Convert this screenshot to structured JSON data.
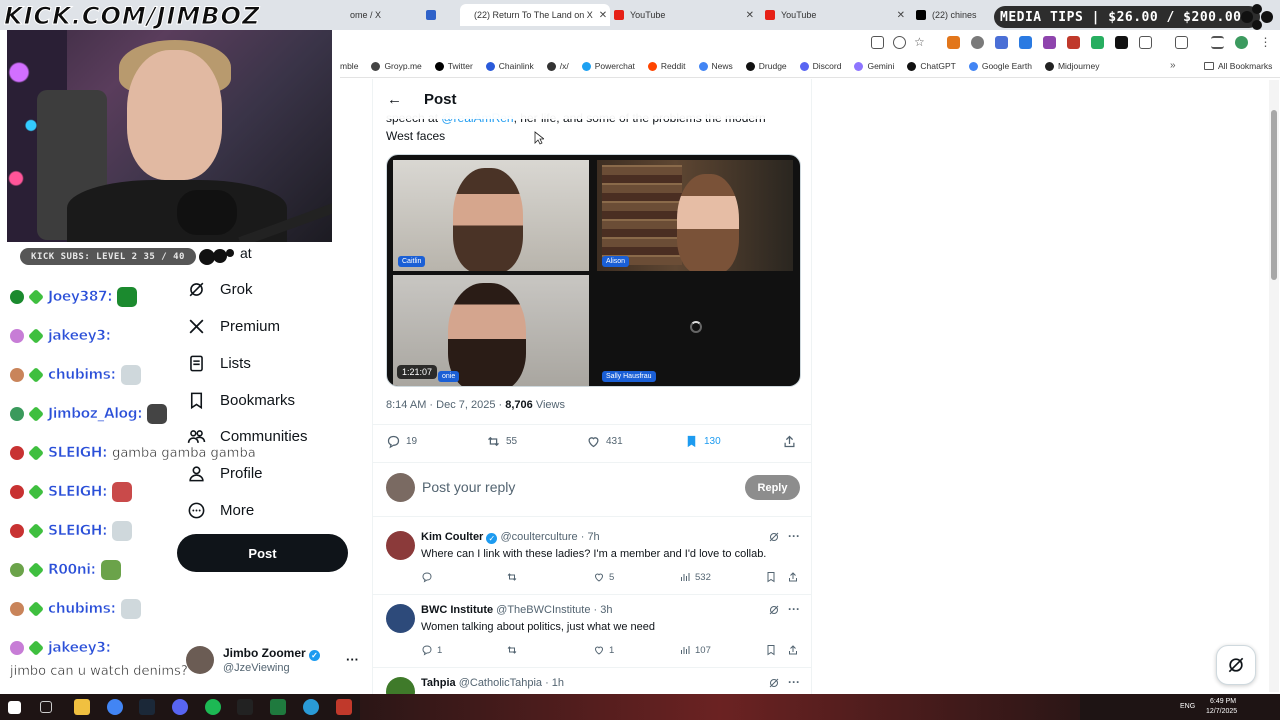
{
  "browser": {
    "tabs": [
      {
        "label": "ome / X",
        "color": "#000000"
      },
      {
        "label": "(22) Return To The Land on X",
        "color": "#000000"
      },
      {
        "label": "YouTube",
        "color": "#ff0000"
      },
      {
        "label": "YouTube",
        "color": "#ff0000"
      },
      {
        "label": "(22) chines",
        "color": "#000000"
      }
    ],
    "bookmarks": [
      {
        "label": "mble",
        "color": "#7cc242"
      },
      {
        "label": "Groyp.me",
        "color": "#444444"
      },
      {
        "label": "Twitter",
        "color": "#000000"
      },
      {
        "label": "Chainlink",
        "color": "#2a5ada"
      },
      {
        "label": "/x/",
        "color": "#333333"
      },
      {
        "label": "Powerchat",
        "color": "#1da1f2"
      },
      {
        "label": "Reddit",
        "color": "#ff4500"
      },
      {
        "label": "News",
        "color": "#4285f4"
      },
      {
        "label": "Drudge",
        "color": "#111111"
      },
      {
        "label": "Discord",
        "color": "#5865f2"
      },
      {
        "label": "Gemini",
        "color": "#8e75ff"
      },
      {
        "label": "ChatGPT",
        "color": "#111111"
      },
      {
        "label": "Google Earth",
        "color": "#4285f4"
      },
      {
        "label": "Midjourney",
        "color": "#222222"
      }
    ],
    "all_bookmarks": "All Bookmarks"
  },
  "stream": {
    "logo_text": "KICK.COM/JIMBOZ",
    "media_tips": "MEDIA TIPS | $26.00 / $200.00",
    "subs": "KICK SUBS: LEVEL 2 35 / 40",
    "chat": [
      {
        "name": "Joey387:",
        "msg": "",
        "badge": "#1b8a2e"
      },
      {
        "name": "jakeey3:",
        "msg": "",
        "badge": "#c77dd6"
      },
      {
        "name": "chubims:",
        "msg": "",
        "badge": "#c9845a"
      },
      {
        "name": "Jimboz_Alog:",
        "msg": "",
        "badge": "#3a9a5c"
      },
      {
        "name": "SLEIGH:",
        "msg": "gamba gamba gamba",
        "badge": "#c83232"
      },
      {
        "name": "SLEIGH:",
        "msg": "",
        "badge": "#c83232"
      },
      {
        "name": "SLEIGH:",
        "msg": "",
        "badge": "#c83232"
      },
      {
        "name": "R00ni:",
        "msg": "",
        "badge": "#6ba34a"
      },
      {
        "name": "chubims:",
        "msg": "",
        "badge": "#c9845a"
      },
      {
        "name": "jakeey3:",
        "msg": "",
        "badge": "#c77dd6"
      }
    ],
    "chat_bottom": "jimbo can u watch denims?"
  },
  "nav": {
    "partial_label": "at",
    "items": [
      {
        "label": "Grok",
        "icon": "grok-icon"
      },
      {
        "label": "Premium",
        "icon": "x-logo-icon"
      },
      {
        "label": "Lists",
        "icon": "lists-icon"
      },
      {
        "label": "Bookmarks",
        "icon": "bookmark-icon"
      },
      {
        "label": "Communities",
        "icon": "communities-icon"
      },
      {
        "label": "Profile",
        "icon": "profile-icon"
      },
      {
        "label": "More",
        "icon": "more-circle-icon"
      }
    ],
    "post_label": "Post",
    "account": {
      "name": "Jimbo Zoomer",
      "handle": "@JzeViewing"
    }
  },
  "post": {
    "header": "Post",
    "text_line1_pre": "speech at ",
    "text_mention": "@realAmRen",
    "text_line1_post": ", her life, and some of the problems the modern",
    "text_line2": "West faces",
    "video": {
      "participants": [
        "Caitlin",
        "Alison",
        "onie",
        "Sally Hausfrau"
      ],
      "duration": "1:21:07"
    },
    "time": "8:14 AM · Dec 7, 2025 · ",
    "views_count": "8,706",
    "views_label": " Views",
    "stats": {
      "replies": "19",
      "reposts": "55",
      "likes": "431",
      "bookmarks": "130"
    },
    "reply_placeholder": "Post your reply",
    "reply_button": "Reply"
  },
  "replies": [
    {
      "name": "Kim Coulter",
      "verified": true,
      "handle": "@coulterculture · 7h",
      "text": "Where can I link with these ladies? I'm a member and I'd love to collab.",
      "replies": "",
      "reposts": "",
      "likes": "5",
      "views": "532",
      "avatar": "#8b3a3a"
    },
    {
      "name": "BWC Institute",
      "verified": false,
      "handle": "@TheBWCInstitute · 3h",
      "text": "Women talking about politics, just what we need",
      "replies": "1",
      "reposts": "",
      "likes": "1",
      "views": "107",
      "avatar": "#2d4a7a"
    },
    {
      "name": "Tahpia",
      "verified": false,
      "handle": "@CatholicTahpia · 1h",
      "text": "",
      "replies": "",
      "reposts": "",
      "likes": "",
      "views": "",
      "avatar": "#3f7a2a"
    }
  ],
  "taskbar": {
    "lang": "ENG",
    "time": "6:49 PM",
    "date": "12/7/2025"
  }
}
